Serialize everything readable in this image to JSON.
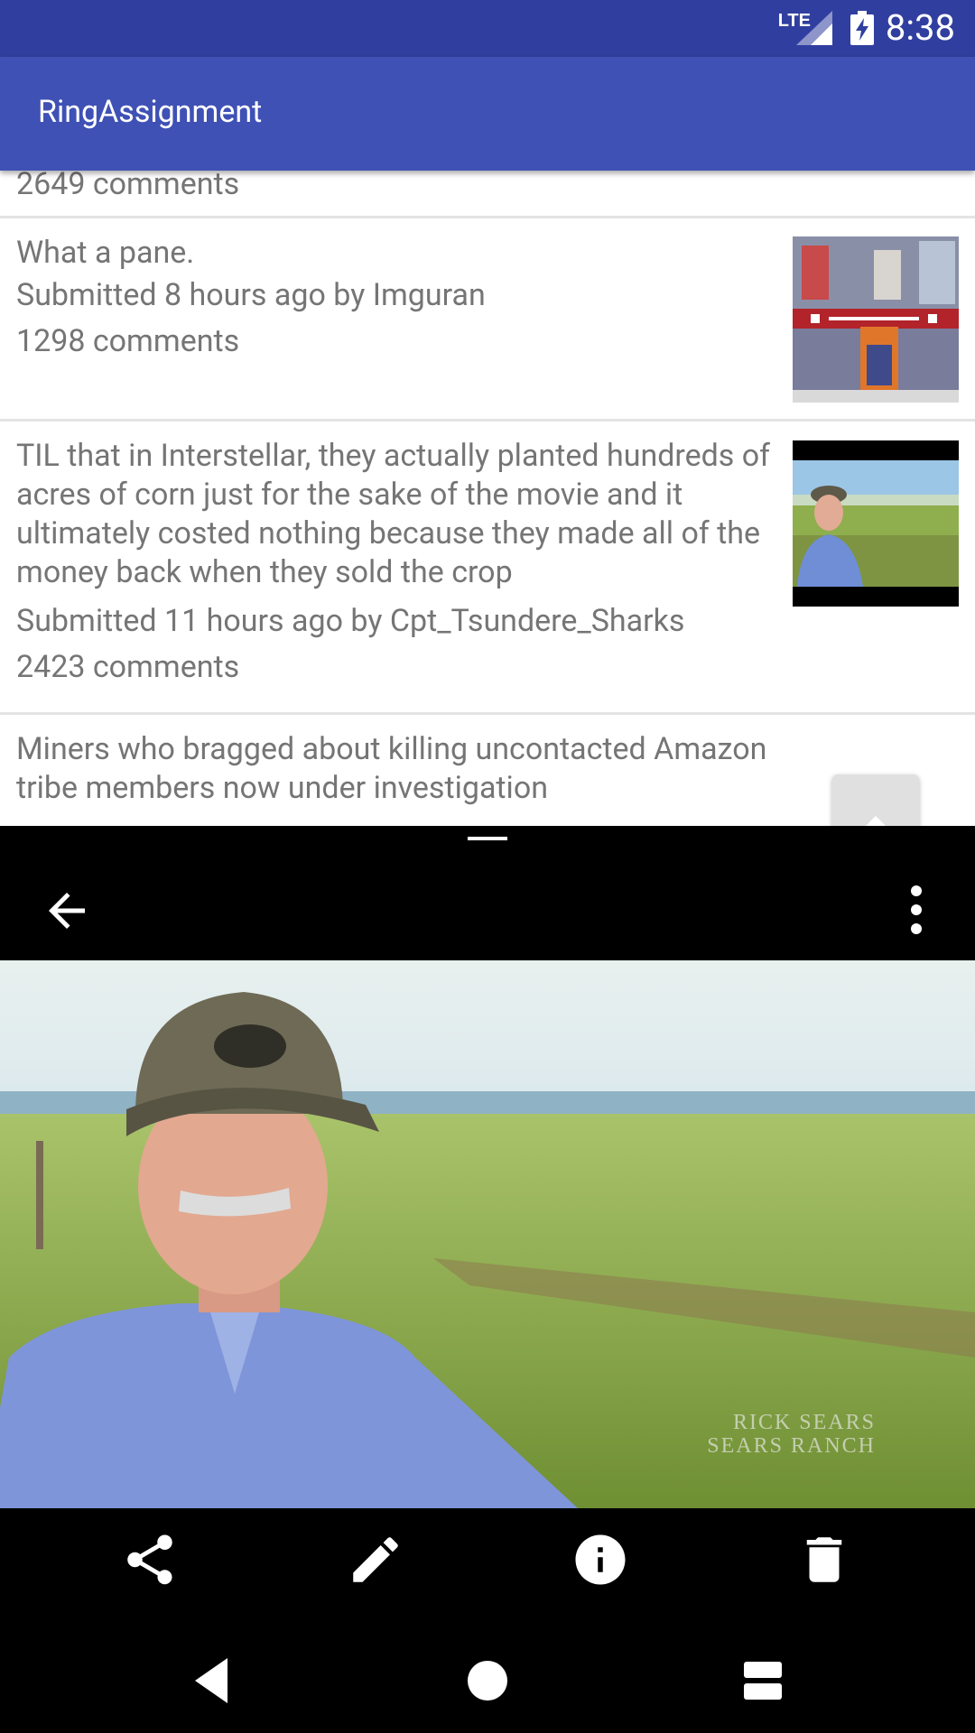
{
  "status_bar": {
    "network": "LTE",
    "time": "8:38"
  },
  "app_bar": {
    "title": "RingAssignment"
  },
  "feed": {
    "items": [
      {
        "comments": "2649 comments"
      },
      {
        "title": "What a pane.",
        "meta": "Submitted 8 hours ago by Imguran",
        "comments": "1298 comments"
      },
      {
        "title": "TIL that in Interstellar, they actually planted hundreds of acres of corn just for the sake of the movie and it ultimately costed nothing because they made all of the money back when they sold the crop",
        "meta": "Submitted 11 hours ago by Cpt_Tsundere_Sharks",
        "comments": "2423 comments"
      },
      {
        "title": "Miners who bragged about killing uncontacted Amazon tribe members now under investigation"
      }
    ]
  },
  "viewer": {
    "caption_line1": "RICK SEARS",
    "caption_line2": "SEARS RANCH",
    "actions": [
      "share-icon",
      "edit-icon",
      "info-icon",
      "delete-icon"
    ]
  },
  "nav_bar": {
    "buttons": [
      "back-icon",
      "home-icon",
      "recents-icon"
    ]
  },
  "colors": {
    "status_bar": "#303f9f",
    "app_bar": "#3f51b5",
    "text_secondary": "#757575",
    "divider": "#e4e4e4"
  }
}
